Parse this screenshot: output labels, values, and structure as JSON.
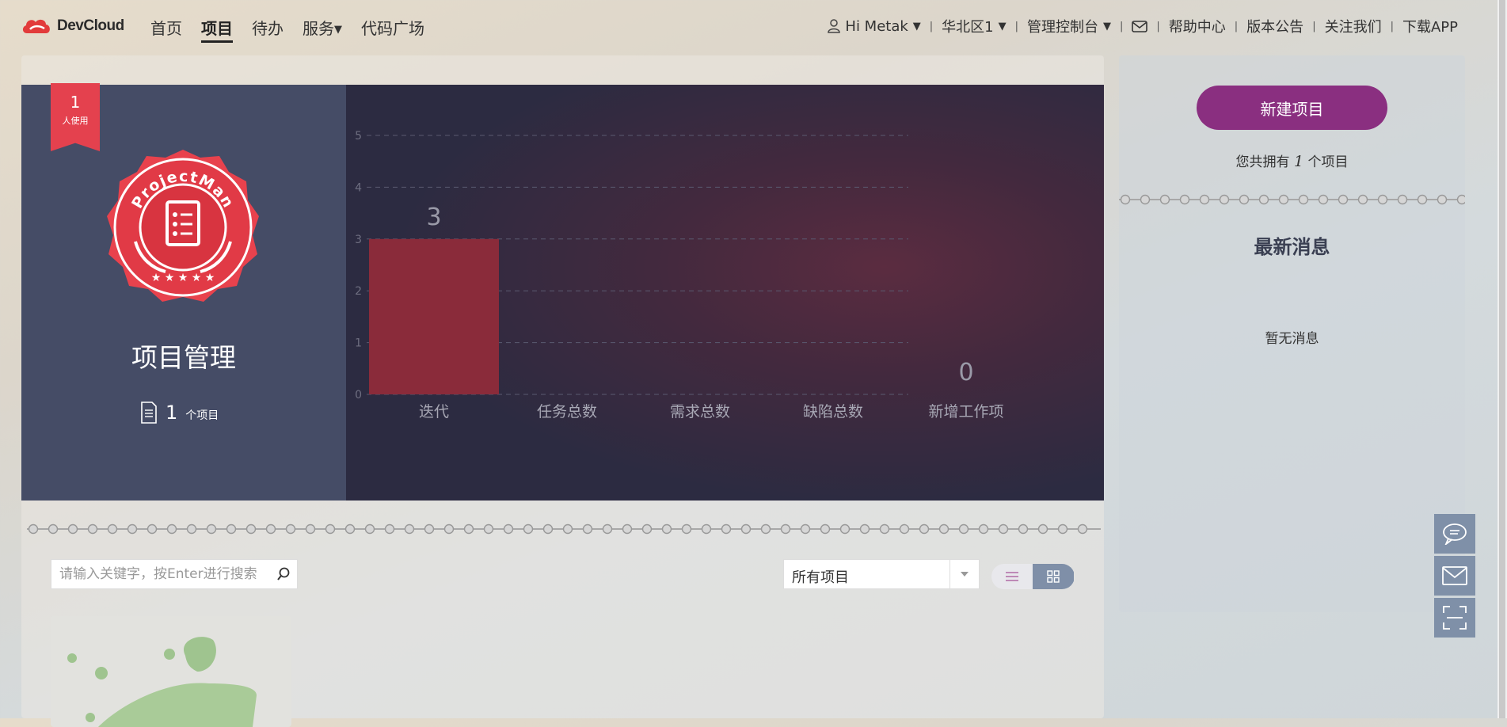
{
  "brand": {
    "name": "DevCloud"
  },
  "nav": {
    "home": "首页",
    "project": "项目",
    "todo": "待办",
    "service": "服务",
    "code": "代码广场"
  },
  "topright": {
    "greeting": "Hi Metak",
    "region": "华北区1",
    "console": "管理控制台",
    "help": "帮助中心",
    "release": "版本公告",
    "follow": "关注我们",
    "download": "下载APP"
  },
  "hero": {
    "ribbon_count": "1",
    "ribbon_label": "人使用",
    "badge_text": "ProjectMan",
    "title": "项目管理",
    "project_count": "1",
    "project_unit": "个项目"
  },
  "chart_data": {
    "type": "bar",
    "categories": [
      "迭代",
      "任务总数",
      "需求总数",
      "缺陷总数",
      "新增工作项"
    ],
    "values": [
      3,
      null,
      null,
      null,
      0
    ],
    "value_labels": [
      "3",
      "",
      "",
      "",
      "0"
    ],
    "ylim": [
      0,
      5
    ],
    "yticks": [
      "0",
      "1",
      "2",
      "3",
      "4",
      "5"
    ],
    "grid": true
  },
  "filters": {
    "search_placeholder": "请输入关键字，按Enter进行搜索",
    "select_value": "所有项目"
  },
  "side": {
    "new_project": "新建项目",
    "own_prefix": "您共拥有",
    "own_count": "1",
    "own_suffix": "个项目",
    "news_title": "最新消息",
    "no_news": "暂无消息"
  },
  "colors": {
    "accent": "#8a2f80",
    "bar": "#8a2b3a",
    "ribbon": "#e4414e",
    "hero_left": "#454c66"
  },
  "icons": {
    "user": "user-icon",
    "mail": "mail-icon",
    "search": "search-icon",
    "chat": "chat-icon",
    "scan": "scan-icon"
  }
}
